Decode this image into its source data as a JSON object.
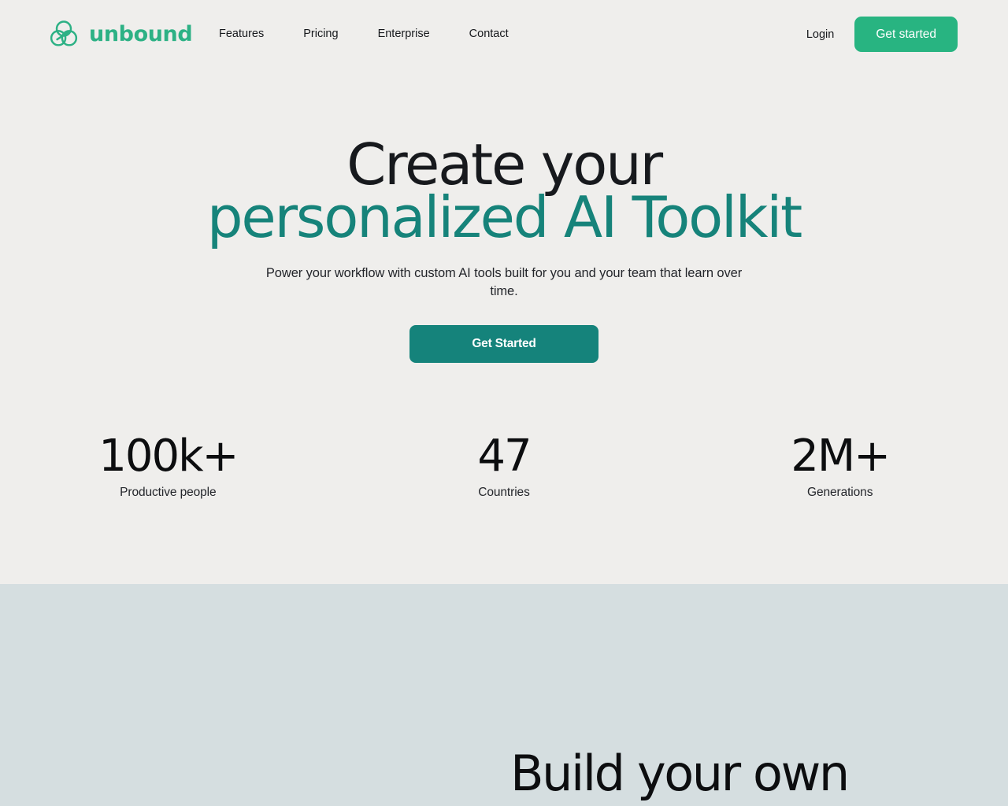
{
  "brand": {
    "name": "unbound",
    "logo_icon": "trefoil-circles-logo-icon",
    "logo_color": "#2db185"
  },
  "header": {
    "nav": [
      {
        "label": "Features"
      },
      {
        "label": "Pricing"
      },
      {
        "label": "Enterprise"
      },
      {
        "label": "Contact"
      }
    ],
    "login_label": "Login",
    "cta_label": "Get started",
    "cta_color": "#28b481",
    "background": "#efeeec"
  },
  "hero": {
    "title_line1": "Create your",
    "title_line2": "personalized AI Toolkit",
    "title_line2_color": "#16837a",
    "subtitle": "Power your workflow with custom AI tools built for you and your team that learn over time.",
    "cta_label": "Get Started",
    "cta_color": "#15837b",
    "background": "#efeeec"
  },
  "stats": [
    {
      "value": "100k+",
      "label": "Productive people"
    },
    {
      "value": "47",
      "label": "Countries"
    },
    {
      "value": "2M+",
      "label": "Generations"
    }
  ],
  "build_section": {
    "title": "Build your own",
    "background": "#d5dee0"
  }
}
